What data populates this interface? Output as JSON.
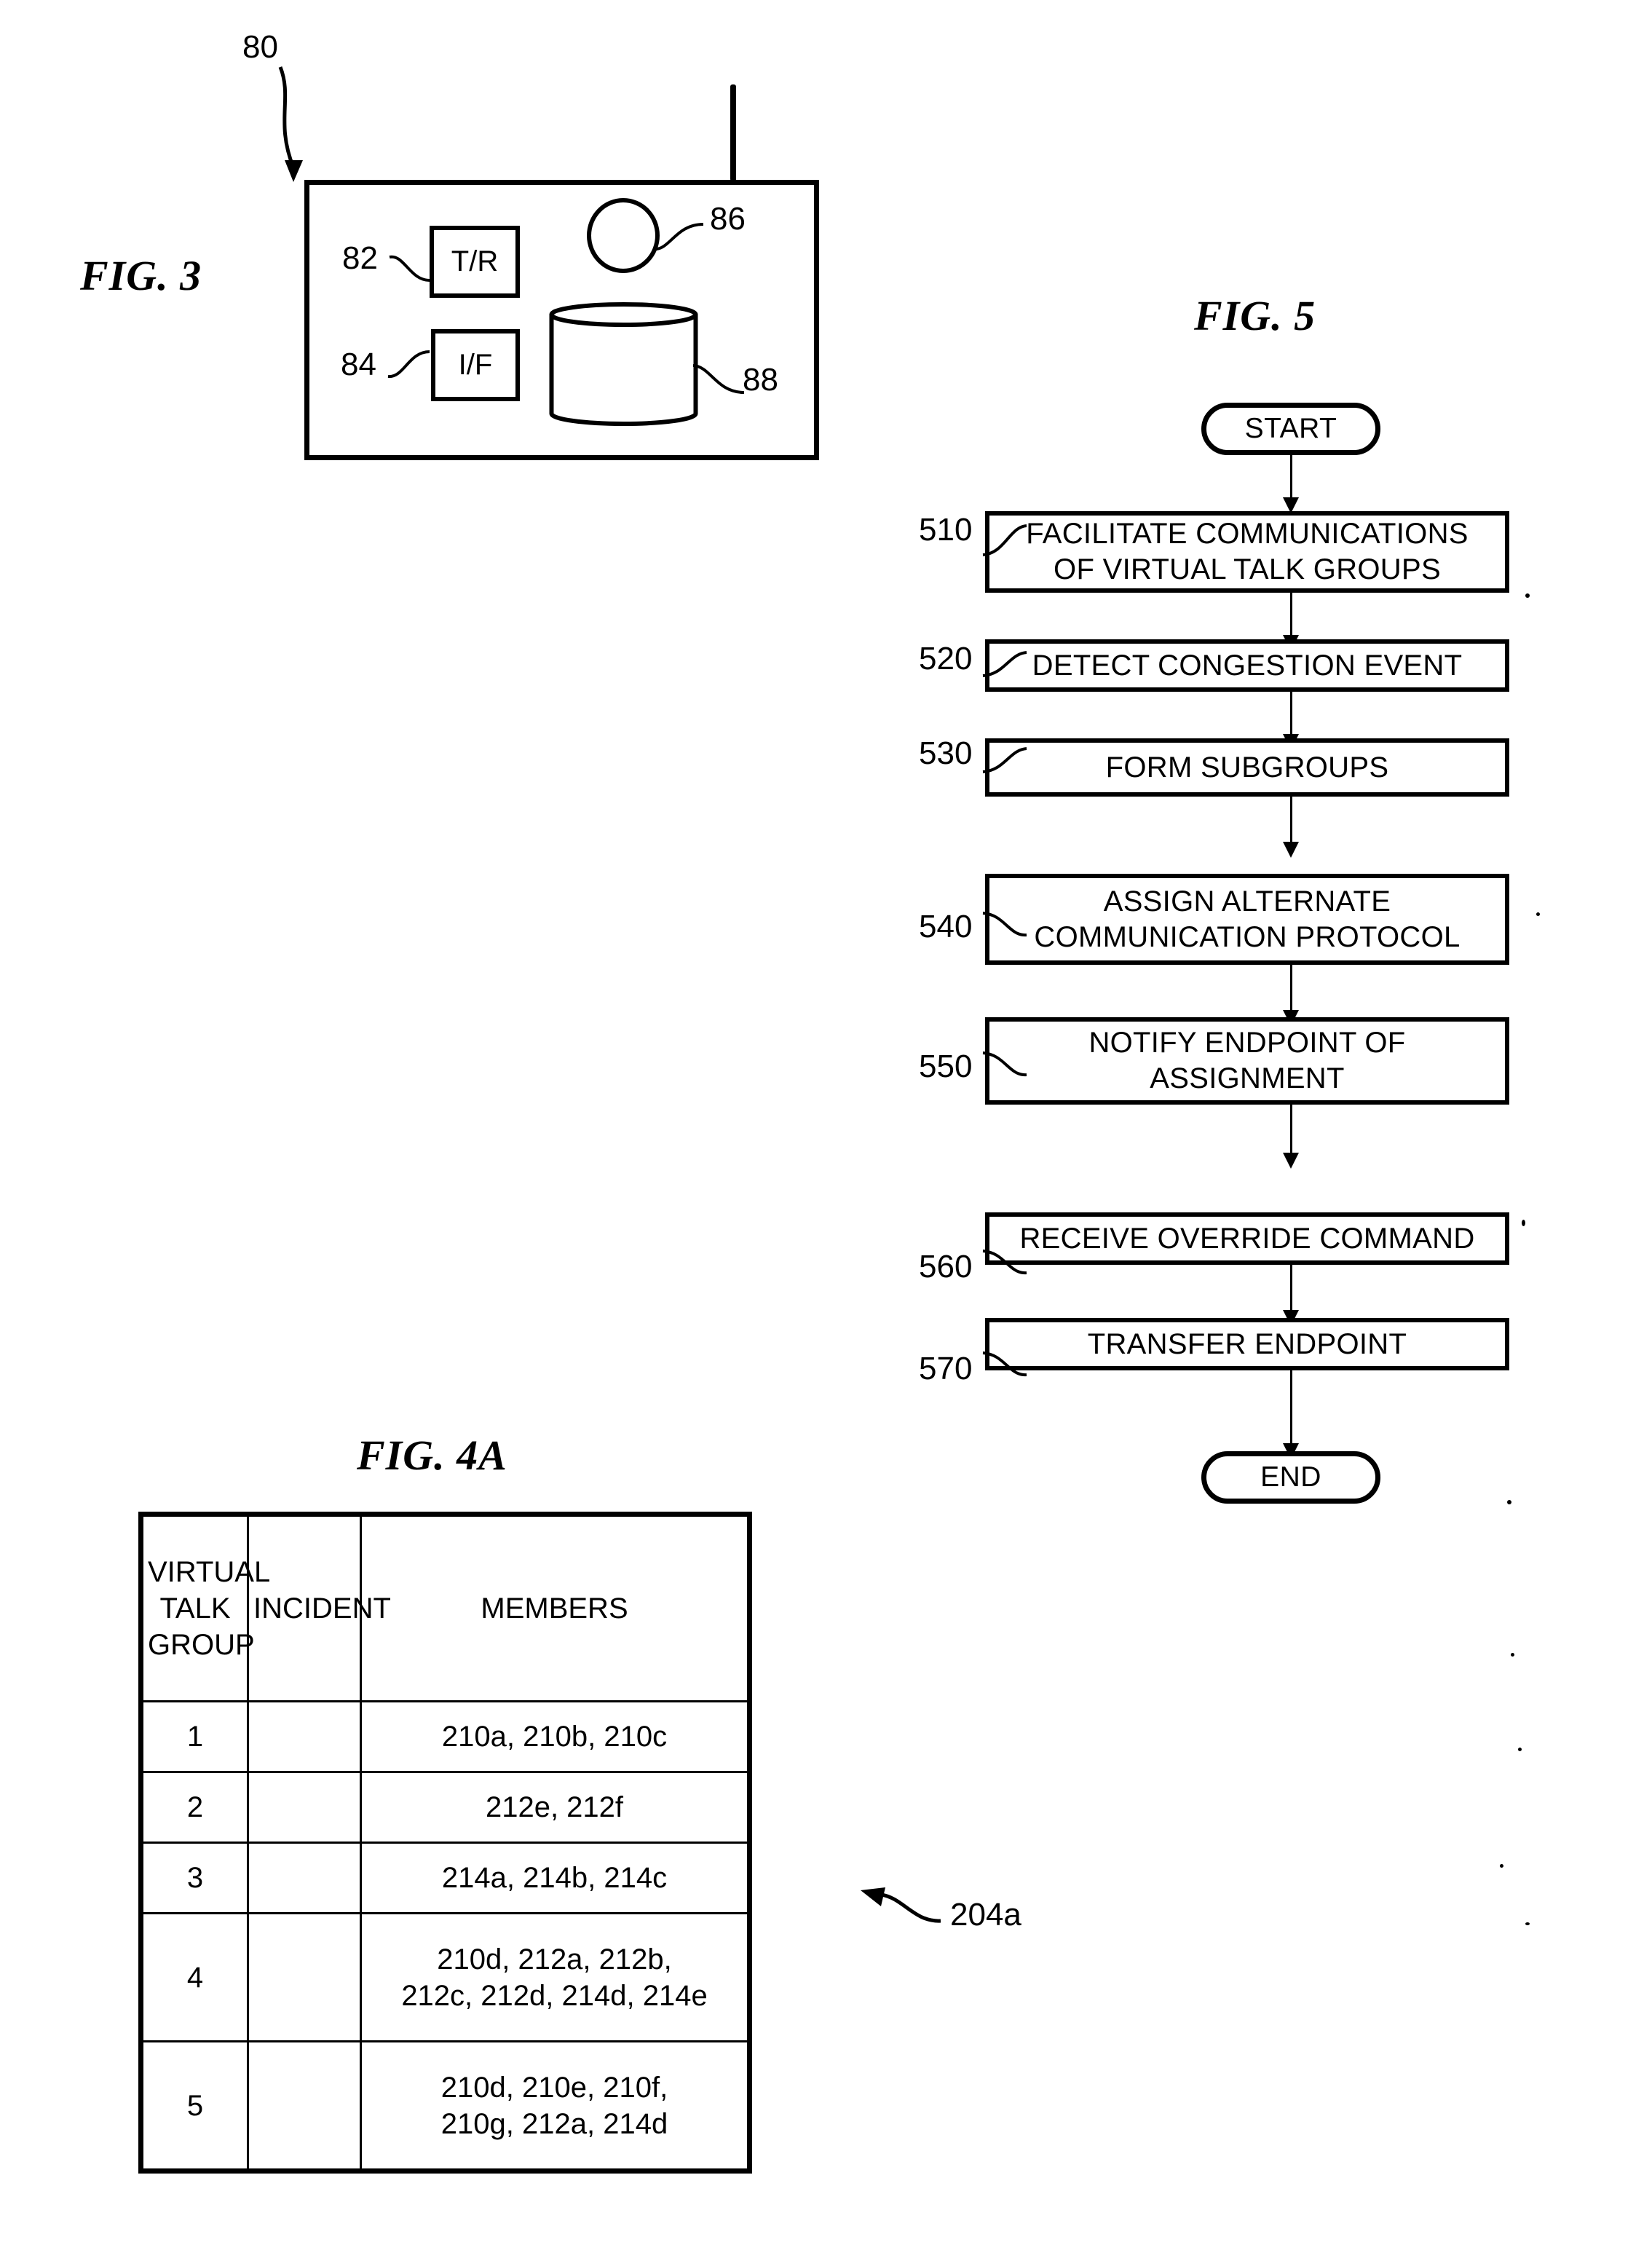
{
  "figures": {
    "fig3": {
      "label": "FIG. 3",
      "device_ref": "80",
      "antenna": "antenna",
      "components": [
        {
          "ref": "82",
          "label": "T/R"
        },
        {
          "ref": "84",
          "label": "I/F"
        },
        {
          "ref": "86",
          "label": ""
        },
        {
          "ref": "88",
          "label": ""
        }
      ]
    },
    "fig5": {
      "label": "FIG. 5",
      "start_label": "START",
      "end_label": "END",
      "steps": [
        {
          "number": "510",
          "lines": [
            "FACILITATE COMMUNICATIONS",
            "OF VIRTUAL TALK GROUPS"
          ]
        },
        {
          "number": "520",
          "lines": [
            "DETECT CONGESTION EVENT"
          ]
        },
        {
          "number": "530",
          "lines": [
            "FORM SUBGROUPS"
          ]
        },
        {
          "number": "540",
          "lines": [
            "ASSIGN ALTERNATE",
            "COMMUNICATION PROTOCOL"
          ]
        },
        {
          "number": "550",
          "lines": [
            "NOTIFY ENDPOINT OF",
            "ASSIGNMENT"
          ]
        },
        {
          "number": "560",
          "lines": [
            "RECEIVE OVERRIDE COMMAND"
          ]
        },
        {
          "number": "570",
          "lines": [
            "TRANSFER ENDPOINT"
          ]
        }
      ]
    },
    "fig4a": {
      "label": "FIG. 4A",
      "table_ref": "204a",
      "headers": [
        "VIRTUAL\nTALK\nGROUP",
        "INCIDENT",
        "MEMBERS"
      ],
      "rows": [
        {
          "group": "1",
          "incident": "",
          "members": "210a, 210b, 210c"
        },
        {
          "group": "2",
          "incident": "",
          "members": "212e, 212f"
        },
        {
          "group": "3",
          "incident": "",
          "members": "214a, 214b, 214c"
        },
        {
          "group": "4",
          "incident": "",
          "members": "210d, 212a, 212b,\n212c, 212d, 214d, 214e"
        },
        {
          "group": "5",
          "incident": "",
          "members": "210d, 210e, 210f,\n210g, 212a, 214d"
        }
      ]
    }
  },
  "colors": {
    "ink": "#000000",
    "paper": "#ffffff"
  }
}
